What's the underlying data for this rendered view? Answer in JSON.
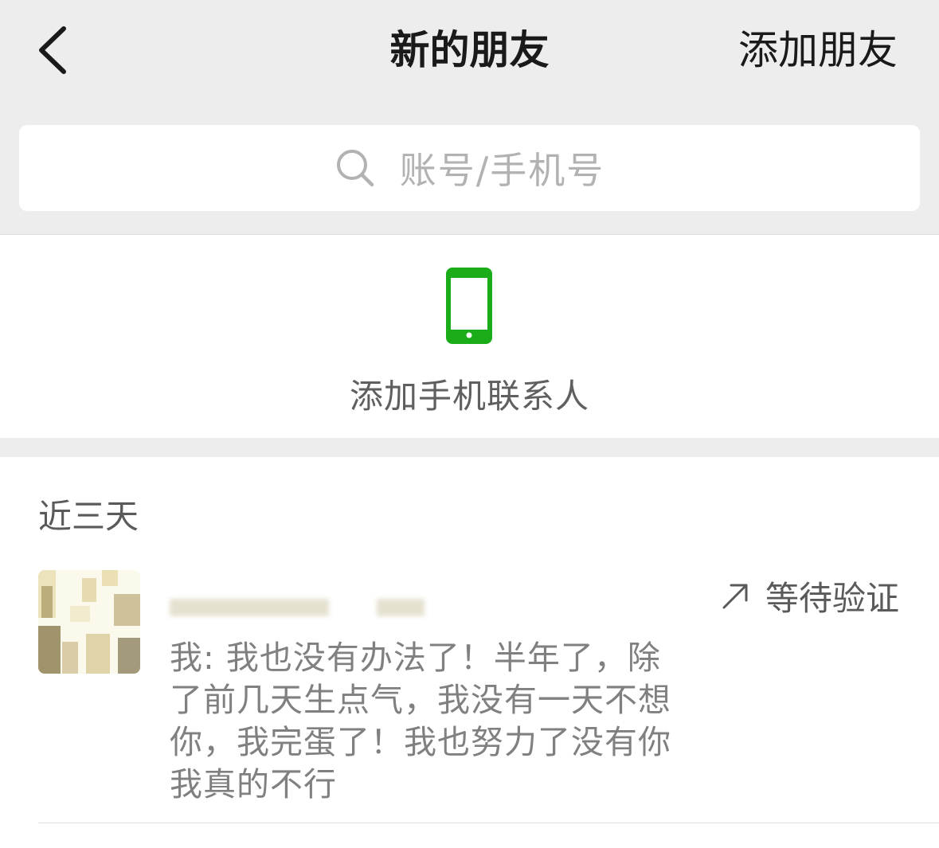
{
  "header": {
    "title": "新的朋友",
    "add_friend_label": "添加朋友"
  },
  "search": {
    "placeholder": "账号/手机号"
  },
  "phone_contacts": {
    "label": "添加手机联系人",
    "icon": "smartphone-icon",
    "icon_color": "#1aad19"
  },
  "recent": {
    "section_title": "近三天",
    "items": [
      {
        "message": "我: 我也没有办法了！半年了，除了前几天生点气，我没有一天不想你，我完蛋了！我也努力了没有你我真的不行",
        "status": "等待验证",
        "status_icon": "arrow-up-right-icon"
      }
    ]
  },
  "colors": {
    "header_bg": "#ededed",
    "accent_green": "#1aad19",
    "placeholder_gray": "#b2b2b2"
  }
}
